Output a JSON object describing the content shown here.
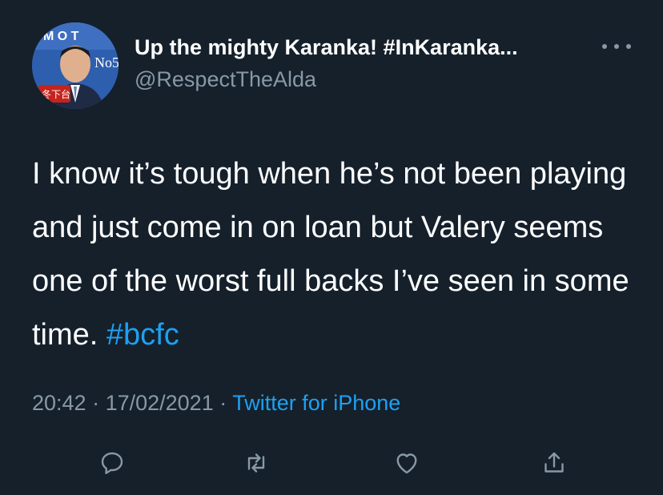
{
  "author": {
    "display_name": "Up the mighty Karanka! #InKaranka...",
    "handle": "@RespectTheAlda"
  },
  "tweet": {
    "text": "I know it’s tough when he’s not been playing and just come in on loan but Valery seems one of the worst full backs I’ve seen in some time. ",
    "hashtag": "#bcfc"
  },
  "meta": {
    "time": "20:42",
    "separator1": " · ",
    "date": "17/02/2021",
    "separator2": " · ",
    "source": "Twitter for iPhone"
  },
  "actions": [
    {
      "name": "reply",
      "icon": "reply-icon"
    },
    {
      "name": "retweet",
      "icon": "retweet-icon"
    },
    {
      "name": "like",
      "icon": "heart-icon"
    },
    {
      "name": "share",
      "icon": "share-icon"
    }
  ],
  "colors": {
    "background": "#15202b",
    "text": "#ffffff",
    "secondary": "#8899a6",
    "accent": "#1da1f2"
  }
}
